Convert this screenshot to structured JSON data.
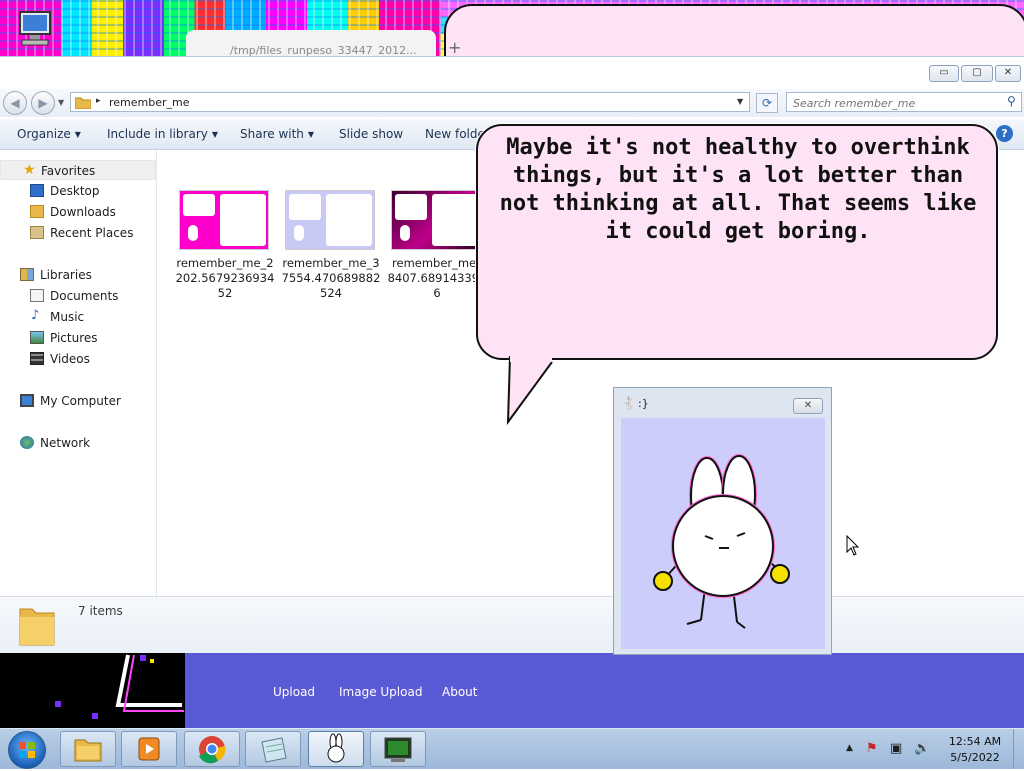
{
  "browser": {
    "tab_title": "/tmp/files_runpeso_33447_2012...",
    "new_tab_label": "+"
  },
  "explorer": {
    "window_controls": {
      "minimize": "▭",
      "maximize": "▢",
      "close": "✕"
    },
    "address": {
      "path": "remember_me"
    },
    "search": {
      "placeholder": "Search remember_me"
    },
    "toolbar": [
      {
        "label": "Organize",
        "has_menu": true
      },
      {
        "label": "Include in library",
        "has_menu": true
      },
      {
        "label": "Share with",
        "has_menu": true
      },
      {
        "label": "Slide show",
        "has_menu": false
      },
      {
        "label": "New folde",
        "has_menu": false
      }
    ],
    "nav": {
      "favorites": "Favorites",
      "desktop": "Desktop",
      "downloads": "Downloads",
      "recent": "Recent Places",
      "libraries": "Libraries",
      "documents": "Documents",
      "music": "Music",
      "pictures": "Pictures",
      "videos": "Videos",
      "my_computer": "My Computer",
      "network": "Network"
    },
    "files": [
      {
        "name": "remember_me_2202.5679236934 52",
        "display": "remember_me_2 202.567923693452",
        "accent": "#ff00cc"
      },
      {
        "name": "remember_me_37554.47068988252 4",
        "display": "remember_me_3 7554.470689882524",
        "accent": "#b9b9f0"
      },
      {
        "name": "remember_me_8407.6891433956",
        "display": "remember_me_ 8407.6891433956",
        "accent": "#3a0030"
      }
    ],
    "status": {
      "item_count": "7 items"
    }
  },
  "speech_bubble": {
    "text": "Maybe it's not healthy to overthink things, but it's a lot better than not thinking at all. That seems like it could get boring."
  },
  "bunny_window": {
    "title": ":}",
    "background": "#cdcdfb"
  },
  "web_strip": {
    "links": [
      "Upload",
      "Image Upload",
      "About"
    ]
  },
  "taskbar": {
    "time": "12:54 AM",
    "date": "5/5/2022",
    "apps": [
      "explorer-icon",
      "media-player-icon",
      "chrome-icon",
      "notepad-icon",
      "bunny-icon",
      "terminal-icon"
    ]
  },
  "colors": {
    "bubble_fill": "#fde3f5",
    "web_strip": "#5a5ad6",
    "taskbar": "#a9c2e0"
  }
}
